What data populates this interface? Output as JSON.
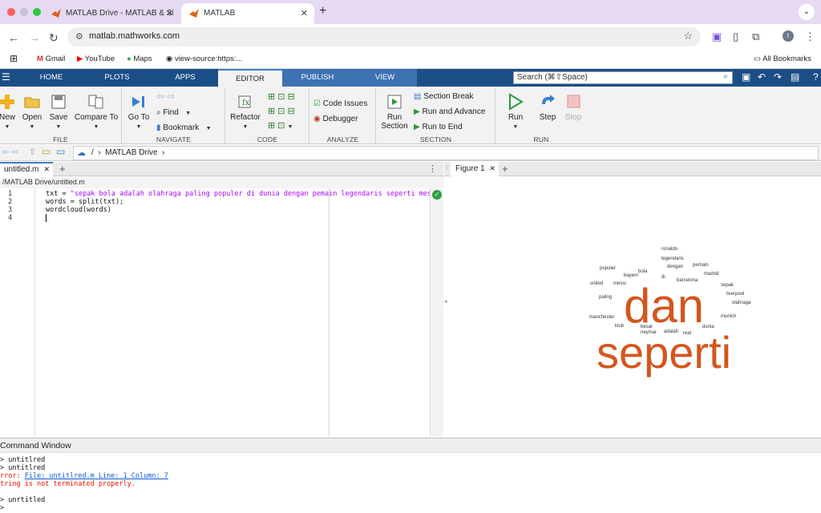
{
  "browser": {
    "tabs": [
      {
        "title": "MATLAB Drive - MATLAB & Si",
        "active": false
      },
      {
        "title": "MATLAB",
        "active": true
      }
    ],
    "url": "matlab.mathworks.com",
    "avatar_letter": "t",
    "bookmarks": [
      "Gmail",
      "YouTube",
      "Maps",
      "view-source:https:...",
      "All Bookmarks"
    ]
  },
  "matlab": {
    "main_tabs": [
      "HOME",
      "PLOTS",
      "APPS",
      "EDITOR",
      "PUBLISH",
      "VIEW"
    ],
    "active_tab": "EDITOR",
    "search_placeholder": "Search (⌘⇧Space)",
    "ribbon": {
      "file": {
        "label": "FILE",
        "new": "New",
        "open": "Open",
        "save": "Save",
        "compare": "Compare To"
      },
      "navigate": {
        "label": "NAVIGATE",
        "goto": "Go To",
        "find": "Find",
        "bookmark": "Bookmark"
      },
      "code": {
        "label": "CODE",
        "refactor": "Refactor"
      },
      "analyze": {
        "label": "ANALYZE",
        "code_issues": "Code Issues",
        "debugger": "Debugger"
      },
      "section": {
        "label": "SECTION",
        "run_section_1": "Run",
        "run_section_2": "Section",
        "section_break": "Section Break",
        "run_advance": "Run and Advance",
        "run_end": "Run to End"
      },
      "run": {
        "label": "RUN",
        "run": "Run",
        "step": "Step",
        "stop": "Stop"
      }
    },
    "address": {
      "root": "/",
      "folder": "MATLAB Drive"
    },
    "editor": {
      "tab": "untitled.m",
      "path": "/MATLAB Drive/untitled.m",
      "lines": [
        {
          "num": "1",
          "pre": "txt = ",
          "str": "\"sepak bola adalah olahraga paling populer di dunia dengan pemain legendaris seperti messi rona"
        },
        {
          "num": "2",
          "pre": "words = split(txt);",
          "str": ""
        },
        {
          "num": "3",
          "pre": "wordcloud(words)",
          "str": ""
        },
        {
          "num": "4",
          "pre": "",
          "str": ""
        }
      ]
    },
    "figure": {
      "tab": "Figure 1",
      "wordcloud": {
        "color_small": "#333333",
        "color_large": "#d3561e",
        "words": [
          "ronaldo",
          "legendaris",
          "pemain",
          "populer",
          "bola",
          "dengan",
          "bayern",
          "madrid",
          "di",
          "barcelona",
          "united",
          "messi",
          "sepak",
          "paling",
          "liverpool",
          "olahraga",
          "manchester",
          "munich",
          "klub",
          "besar",
          "neymar",
          "adalah",
          "real",
          "dunia",
          "dan",
          "seperti"
        ]
      }
    },
    "command_window": {
      "title": "Command Window",
      "lines": [
        {
          "type": "normal",
          "text": "> untitlred"
        },
        {
          "type": "normal",
          "text": "> untitlred"
        },
        {
          "type": "error",
          "prefix": "rror: ",
          "link": "File: untitlred.m Line: 1 Column: 7"
        },
        {
          "type": "error",
          "text": "tring is not terminated properly."
        },
        {
          "type": "blank",
          "text": ""
        },
        {
          "type": "normal",
          "text": "> unrtitled"
        },
        {
          "type": "normal",
          "text": ">"
        }
      ]
    }
  }
}
